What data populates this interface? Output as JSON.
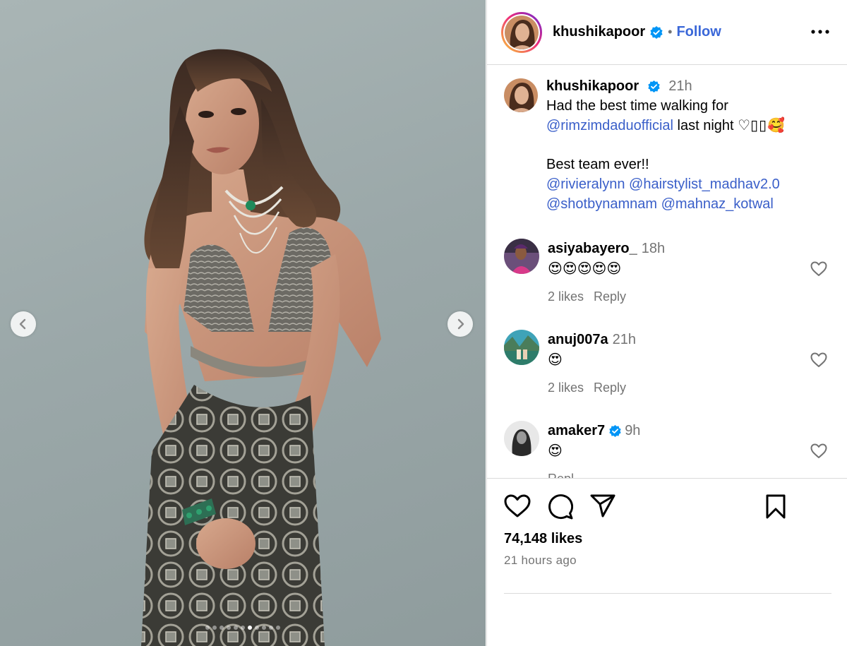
{
  "post": {
    "username": "khushikapoor",
    "follow_label": "Follow",
    "separator": "•",
    "carousel": {
      "slide_count": 11,
      "active_index": 6
    }
  },
  "caption": {
    "username": "khushikapoor",
    "time": "21h",
    "line1": "Had the best time walking for",
    "mention1": "@rimzimdaduofficial",
    "line2_rest": " last night ♡",
    "line2_emoji": "🥰",
    "line3": "Best team ever!!",
    "mention2": "@rivieralynn",
    "mention3": "@hairstylist_madhav2.0",
    "mention4": "@shotbynamnam",
    "mention5": "@mahnaz_kotwal"
  },
  "comments": [
    {
      "username": "asiyabayero_",
      "time": "18h",
      "text": "😍😍😍😍😍",
      "likes": "2 likes",
      "reply": "Reply"
    },
    {
      "username": "anuj007a",
      "time": "21h",
      "text": "😍",
      "likes": "2 likes",
      "reply": "Reply"
    },
    {
      "username": "amaker7",
      "time": "9h",
      "text": "😍",
      "reply": "Repl"
    }
  ],
  "footer": {
    "likes": "74,148 likes",
    "posted": "21 hours ago"
  },
  "colors": {
    "link": "#3a5fc9",
    "muted": "#737373",
    "verified": "#0095f6"
  }
}
